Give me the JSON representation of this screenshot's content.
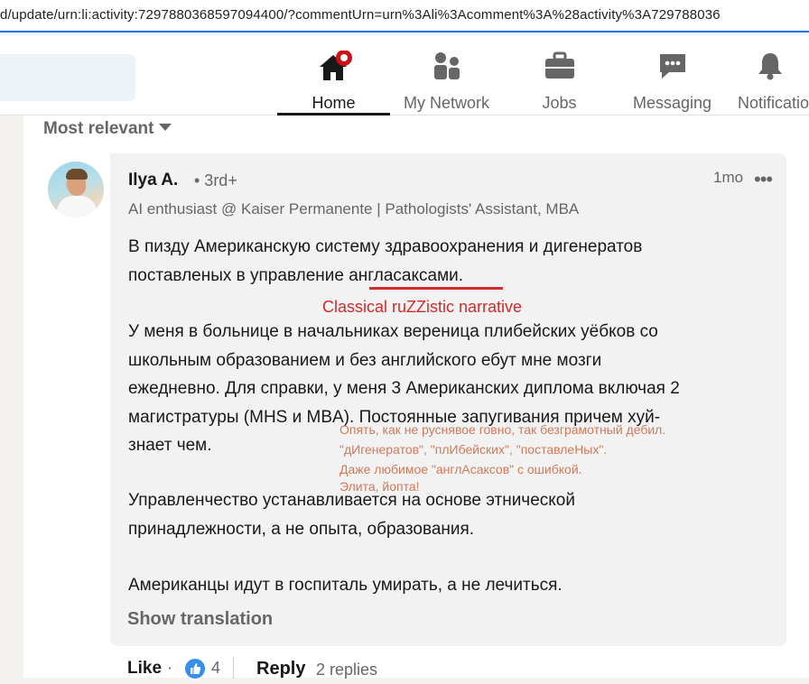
{
  "browser": {
    "url": "d/update/urn:li:activity:7297880368597094400/?commentUrn=urn%3Ali%3Acomment%3A%28activity%3A729788036"
  },
  "nav": {
    "items": [
      {
        "label": "Home",
        "icon": "home-icon",
        "active": true,
        "badge": true
      },
      {
        "label": "My Network",
        "icon": "network-icon",
        "active": false
      },
      {
        "label": "Jobs",
        "icon": "briefcase-icon",
        "active": false
      },
      {
        "label": "Messaging",
        "icon": "messaging-icon",
        "active": false
      },
      {
        "label": "Notificatio",
        "icon": "bell-icon",
        "active": false
      }
    ]
  },
  "comments": {
    "sort_label": "Most relevant"
  },
  "comment": {
    "author": "Ilya A.",
    "degree": "• 3rd+",
    "time": "1mo",
    "more": "•••",
    "headline": "AI enthusiast @ Kaiser Permanente | Pathologists' Assistant, MBA",
    "para1_line1": "В пизду Американскую систему здравоохранения и дигенератов",
    "para1_line2": "поставленых в управление англасаксами.",
    "para2_line1": "У меня в больнице в начальниках вереница плибейских уёбков со",
    "para2_line2": "школьным образованием и без английского ебут мне мозги",
    "para2_line3": "ежедневно. Для справки, у меня 3 Американских диплома включая 2",
    "para2_line4": "магистратуры (MHS и MBA). Постоянные запугивания причем хуй-",
    "para2_line5": "знает чем.",
    "para3_line1": "Управленчество устанавливается на основе этнической",
    "para3_line2": "принадлежности, а не опыта, образования.",
    "para4_line1": "Американцы идут в госпиталь умирать, а не лечиться.",
    "show_translation": "Show translation",
    "like_label": "Like",
    "like_count": "4",
    "reply_label": "Reply",
    "replies_label": "2 replies"
  },
  "annotations": {
    "red_note": "Classical ruZZistic narrative",
    "orange_line1": "Опять, как не руснявое говно, так безграмотный дебил.",
    "orange_line2": "\"дИгенератов\", \"плИбейских\", \"поставлеНых\".",
    "orange_line3": "Даже любимое \"англАсаксов\" с ошибкой.",
    "orange_line4": "Элита, йопта!"
  },
  "colors": {
    "accent_red": "#d42a2a",
    "annotation_orange": "#d07a5a",
    "like_blue": "#378fe9"
  }
}
